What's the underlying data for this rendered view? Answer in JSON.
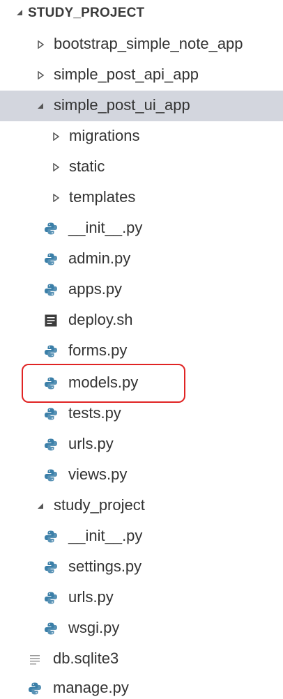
{
  "explorer": {
    "section_title": "STUDY_PROJECT",
    "items": [
      {
        "label": "bootstrap_simple_note_app",
        "kind": "folder",
        "state": "collapsed"
      },
      {
        "label": "simple_post_api_app",
        "kind": "folder",
        "state": "collapsed"
      },
      {
        "label": "simple_post_ui_app",
        "kind": "folder",
        "state": "expanded",
        "selected": true
      },
      {
        "label": "migrations",
        "kind": "folder",
        "state": "collapsed"
      },
      {
        "label": "static",
        "kind": "folder",
        "state": "collapsed"
      },
      {
        "label": "templates",
        "kind": "folder",
        "state": "collapsed"
      },
      {
        "label": "__init__.py",
        "kind": "python-file"
      },
      {
        "label": "admin.py",
        "kind": "python-file"
      },
      {
        "label": "apps.py",
        "kind": "python-file"
      },
      {
        "label": "deploy.sh",
        "kind": "shell-file"
      },
      {
        "label": "forms.py",
        "kind": "python-file"
      },
      {
        "label": "models.py",
        "kind": "python-file",
        "highlighted": true
      },
      {
        "label": "tests.py",
        "kind": "python-file"
      },
      {
        "label": "urls.py",
        "kind": "python-file"
      },
      {
        "label": "views.py",
        "kind": "python-file"
      },
      {
        "label": "study_project",
        "kind": "folder",
        "state": "expanded"
      },
      {
        "label": "__init__.py",
        "kind": "python-file"
      },
      {
        "label": "settings.py",
        "kind": "python-file"
      },
      {
        "label": "urls.py",
        "kind": "python-file"
      },
      {
        "label": "wsgi.py",
        "kind": "python-file"
      },
      {
        "label": "db.sqlite3",
        "kind": "text-file"
      },
      {
        "label": "manage.py",
        "kind": "python-file"
      }
    ]
  },
  "colors": {
    "selected_background": "#d3d6de",
    "highlight_border": "#e02424",
    "python_icon": "#3b7fa8",
    "twist_color": "#555555"
  },
  "icons": {
    "folder_collapsed": "chevron-right-icon",
    "folder_expanded": "chevron-down-icon",
    "python_file": "python-file-icon",
    "shell_file": "shell-file-icon",
    "text_file": "text-file-icon"
  }
}
